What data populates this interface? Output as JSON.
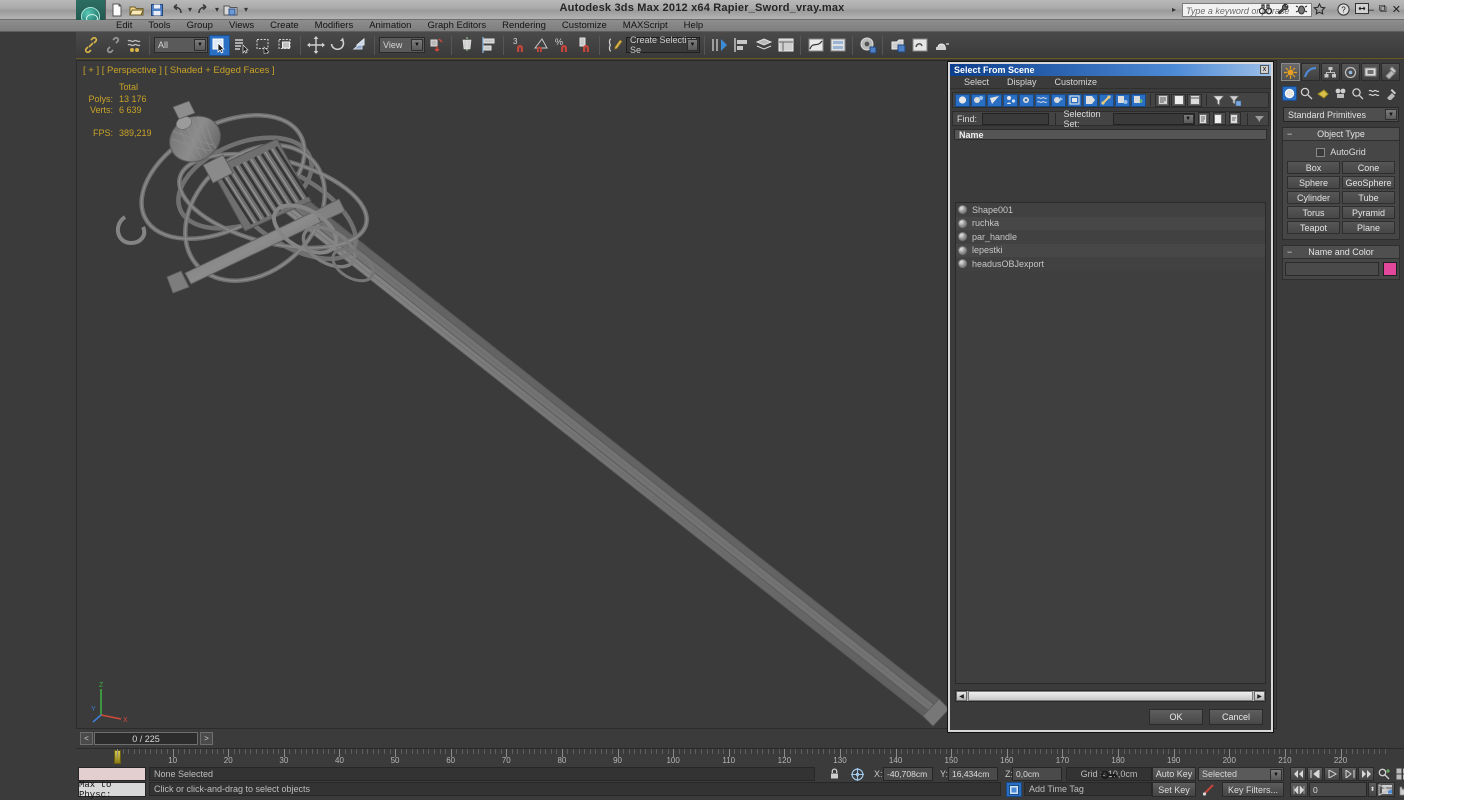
{
  "app": {
    "title": "Autodesk 3ds Max  2012 x64     Rapier_Sword_vray.max",
    "search_placeholder": "Type a keyword or phrase"
  },
  "menu": {
    "items": [
      "Edit",
      "Tools",
      "Group",
      "Views",
      "Create",
      "Modifiers",
      "Animation",
      "Graph Editors",
      "Rendering",
      "Customize",
      "MAXScript",
      "Help"
    ]
  },
  "toolbar": {
    "selection_filter": "All",
    "ref_coord_system": "View",
    "named_selection_set": "Create Selection Se"
  },
  "viewport": {
    "label": "[ + ] [ Perspective ] [ Shaded + Edged Faces ]",
    "stats": {
      "header": "Total",
      "polys_label": "Polys:",
      "polys_value": "13 176",
      "verts_label": "Verts:",
      "verts_value": "6 639",
      "fps_label": "FPS:",
      "fps_value": "389,219"
    },
    "axis": {
      "x": "X",
      "y": "Y",
      "z": "Z"
    }
  },
  "dialog": {
    "title": "Select From Scene",
    "close_label": "x",
    "menu": [
      "Select",
      "Display",
      "Customize"
    ],
    "find_label": "Find:",
    "find_value": "",
    "selection_set_label": "Selection Set:",
    "selection_set_value": "",
    "column_header": "Name",
    "objects": [
      {
        "name": "Shape001"
      },
      {
        "name": "ruchka"
      },
      {
        "name": "par_handle"
      },
      {
        "name": "lepestki"
      },
      {
        "name": "headusOBJexport"
      }
    ],
    "ok_label": "OK",
    "cancel_label": "Cancel"
  },
  "command_panel": {
    "primitive_type": "Standard Primitives",
    "object_type": {
      "header": "Object Type",
      "autogrid_label": "AutoGrid",
      "buttons": [
        "Box",
        "Cone",
        "Sphere",
        "GeoSphere",
        "Cylinder",
        "Tube",
        "Torus",
        "Pyramid",
        "Teapot",
        "Plane"
      ]
    },
    "name_and_color": {
      "header": "Name and Color",
      "name_value": "",
      "color": "#e2479c"
    }
  },
  "trackbar": {
    "time_display": "0 / 225",
    "prev_label": "<",
    "next_label": ">",
    "ticks": [
      10,
      20,
      30,
      40,
      50,
      60,
      70,
      80,
      90,
      100,
      110,
      120,
      130,
      140,
      150,
      160,
      170,
      180,
      190,
      200,
      210,
      220
    ]
  },
  "statusbar": {
    "max_to_physc": "Max to Physc:",
    "selection_status": "None Selected",
    "prompt": "Click or click-and-drag to select objects",
    "coords": {
      "x_label": "X:",
      "x_value": "-40,708cm",
      "y_label": "Y:",
      "y_value": "16,434cm",
      "z_label": "Z:",
      "z_value": "0,0cm"
    },
    "grid": "Grid = 10,0cm",
    "add_time_tag": "Add Time Tag",
    "auto_key": "Auto Key",
    "set_key": "Set Key",
    "key_mode": "Selected",
    "key_filters": "Key Filters...",
    "frame_value": "0"
  }
}
